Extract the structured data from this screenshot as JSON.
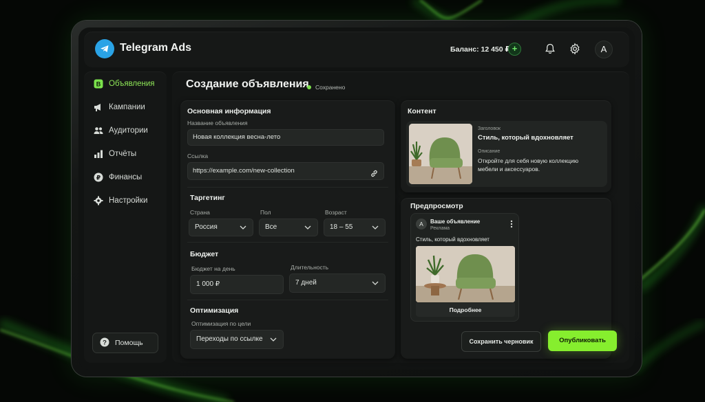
{
  "app": {
    "title": "Telegram Ads"
  },
  "header": {
    "balance": "Баланс: 12 450 ₽",
    "add_label": "+",
    "avatar_letter": "A"
  },
  "sidebar": {
    "items": [
      {
        "label": "Объявления",
        "icon": "ads-icon",
        "active": true
      },
      {
        "label": "Кампании",
        "icon": "megaphone-icon"
      },
      {
        "label": "Аудитории",
        "icon": "users-icon"
      },
      {
        "label": "Отчёты",
        "icon": "bar-chart-icon"
      },
      {
        "label": "Финансы",
        "icon": "ruble-icon"
      },
      {
        "label": "Настройки",
        "icon": "gear-icon"
      }
    ],
    "help_label": "Помощь"
  },
  "page": {
    "title": "Создание объявления",
    "status": "Сохранено"
  },
  "basic": {
    "section_title": "Основная информация",
    "name_label": "Название объявления",
    "name_value": "Новая коллекция весна-лето",
    "link_label": "Ссылка",
    "link_value": "https://example.com/new-collection"
  },
  "targeting": {
    "section_title": "Таргетинг",
    "country_label": "Страна",
    "country_value": "Россия",
    "gender_label": "Пол",
    "gender_value": "Все",
    "age_label": "Возраст",
    "age_value": "18 – 55"
  },
  "budget": {
    "section_title": "Бюджет",
    "daily_label": "Бюджет на день",
    "daily_value": "1 000 ₽",
    "duration_label": "Длительность",
    "duration_value": "7 дней"
  },
  "optimization": {
    "section_title": "Оптимизация",
    "goal_label": "Оптимизация по цели",
    "goal_value": "Переходы по ссылке"
  },
  "content": {
    "section_title": "Контент",
    "headline_label": "Заголовок",
    "headline_value": "Стиль, который вдохновляет",
    "description_label": "Описание",
    "description_value": "Откройте для себя новую коллекцию мебели и аксессуаров."
  },
  "preview": {
    "section_title": "Предпросмотр",
    "channel_letter": "A",
    "channel_name": "Ваше объявление",
    "channel_sub": "Реклама",
    "post_text": "Стиль, который вдохновляет",
    "button_label": "Подробнее"
  },
  "actions": {
    "draft_label": "Сохранить черновик",
    "publish_label": "Опубликовать"
  },
  "colors": {
    "accent": "#86ee2e",
    "telegram_blue": "#2aa3e6",
    "background": "#050705"
  }
}
